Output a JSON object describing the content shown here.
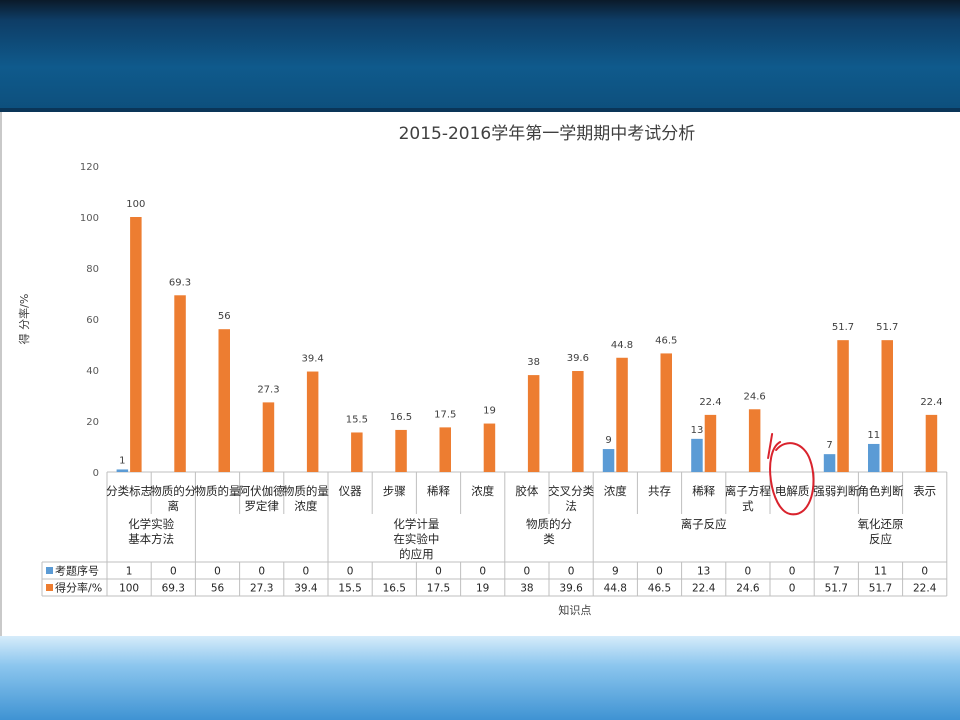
{
  "chart_data": {
    "type": "bar",
    "title": "2015-2016学年第一学期期中考试分析",
    "ylabel": "得 分率/%",
    "xlabel": "知识点",
    "ylim": [
      0,
      120
    ],
    "yticks": [
      0,
      20,
      40,
      60,
      80,
      100,
      120
    ],
    "categories": [
      [
        "分类标志"
      ],
      [
        "物质的分",
        "离"
      ],
      [
        "物质的量"
      ],
      [
        "阿伏伽德",
        "罗定律"
      ],
      [
        "物质的量",
        "浓度"
      ],
      [
        "仪器"
      ],
      [
        "步骤"
      ],
      [
        "稀释"
      ],
      [
        "浓度"
      ],
      [
        "胶体"
      ],
      [
        "交叉分类",
        "法"
      ],
      [
        "浓度"
      ],
      [
        "共存"
      ],
      [
        "稀释"
      ],
      [
        "离子方程",
        "式"
      ],
      [
        "电解质"
      ],
      [
        "强弱判断"
      ],
      [
        "角色判断"
      ],
      [
        "表示"
      ]
    ],
    "groups": [
      {
        "label": [
          "化学实验",
          "基本方法"
        ],
        "span": 2
      },
      {
        "label": [
          ""
        ],
        "span": 3
      },
      {
        "label": [
          "化学计量",
          "在实验中",
          "的应用"
        ],
        "span": 4
      },
      {
        "label": [
          "物质的分",
          "类"
        ],
        "span": 2
      },
      {
        "label": [
          "离子反应"
        ],
        "span": 5
      },
      {
        "label": [
          "氧化还原",
          "反应"
        ],
        "span": 3
      }
    ],
    "series": [
      {
        "name": "考题序号",
        "color": "#5b9bd5",
        "values": [
          1,
          0,
          0,
          0,
          0,
          0,
          null,
          0,
          0,
          0,
          0,
          9,
          0,
          13,
          0,
          0,
          7,
          11,
          0
        ],
        "labels": [
          "1",
          "0",
          "0",
          "0",
          "0",
          "0",
          "",
          "0",
          "0",
          "0",
          "0",
          "9",
          "0",
          "13",
          "0",
          "0",
          "7",
          "11",
          "0"
        ]
      },
      {
        "name": "得分率/%",
        "color": "#ed7d31",
        "values": [
          100,
          69.3,
          56,
          27.3,
          39.4,
          15.5,
          16.5,
          17.5,
          19,
          38,
          39.6,
          44.8,
          46.5,
          22.4,
          24.6,
          0,
          51.7,
          51.7,
          22.4
        ],
        "labels": [
          "100",
          "69.3",
          "56",
          "27.3",
          "39.4",
          "15.5",
          "16.5",
          "17.5",
          "19",
          "38",
          "39.6",
          "44.8",
          "46.5",
          "22.4",
          "24.6",
          "0",
          "51.7",
          "51.7",
          "22.4"
        ]
      }
    ],
    "grid": false,
    "legend": "table-below",
    "annotation": {
      "type": "hand-drawn-circle",
      "target_category_index": 15,
      "color": "#d9232d"
    }
  }
}
